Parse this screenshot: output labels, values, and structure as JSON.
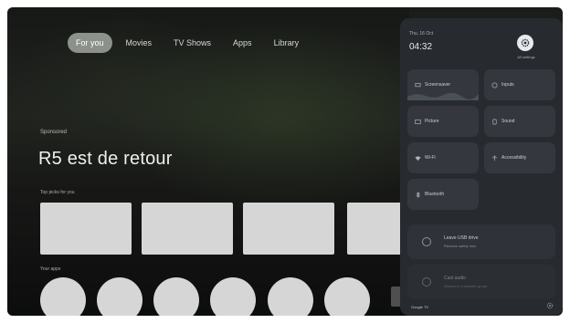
{
  "nav": {
    "tabs": [
      {
        "label": "For you",
        "active": true
      },
      {
        "label": "Movies"
      },
      {
        "label": "TV Shows"
      },
      {
        "label": "Apps"
      },
      {
        "label": "Library"
      }
    ]
  },
  "hero": {
    "sponsored_label": "Sponsored",
    "title": "R5 est de retour"
  },
  "rows": {
    "row1_label": "Top picks for you",
    "row2_label": "Your apps"
  },
  "panel": {
    "date": "Thu, 16 Oct",
    "time": "04:32",
    "all_settings_label": "All settings",
    "tiles": [
      {
        "label": "Screensaver",
        "icon": "screensaver-icon"
      },
      {
        "label": "Inputs",
        "icon": "inputs-icon"
      },
      {
        "label": "Picture",
        "icon": "picture-icon"
      },
      {
        "label": "Sound",
        "icon": "sound-icon"
      },
      {
        "label": "Wi-Fi",
        "icon": "wifi-icon"
      },
      {
        "label": "Accessibility",
        "icon": "accessibility-icon"
      },
      {
        "label": "Bluetooth",
        "icon": "bluetooth-icon"
      }
    ],
    "wide_tiles": [
      {
        "title": "Leave USB drive",
        "subtitle": "Remove safely now"
      },
      {
        "title": "Cast audio",
        "subtitle": "Stream to a speaker group"
      }
    ],
    "footer_label": "Google TV"
  },
  "colors": {
    "panel_bg": "#272a2f",
    "tile_bg": "#34383e",
    "placeholder": "#d6d6d6",
    "active_tab": "#8c918b"
  }
}
